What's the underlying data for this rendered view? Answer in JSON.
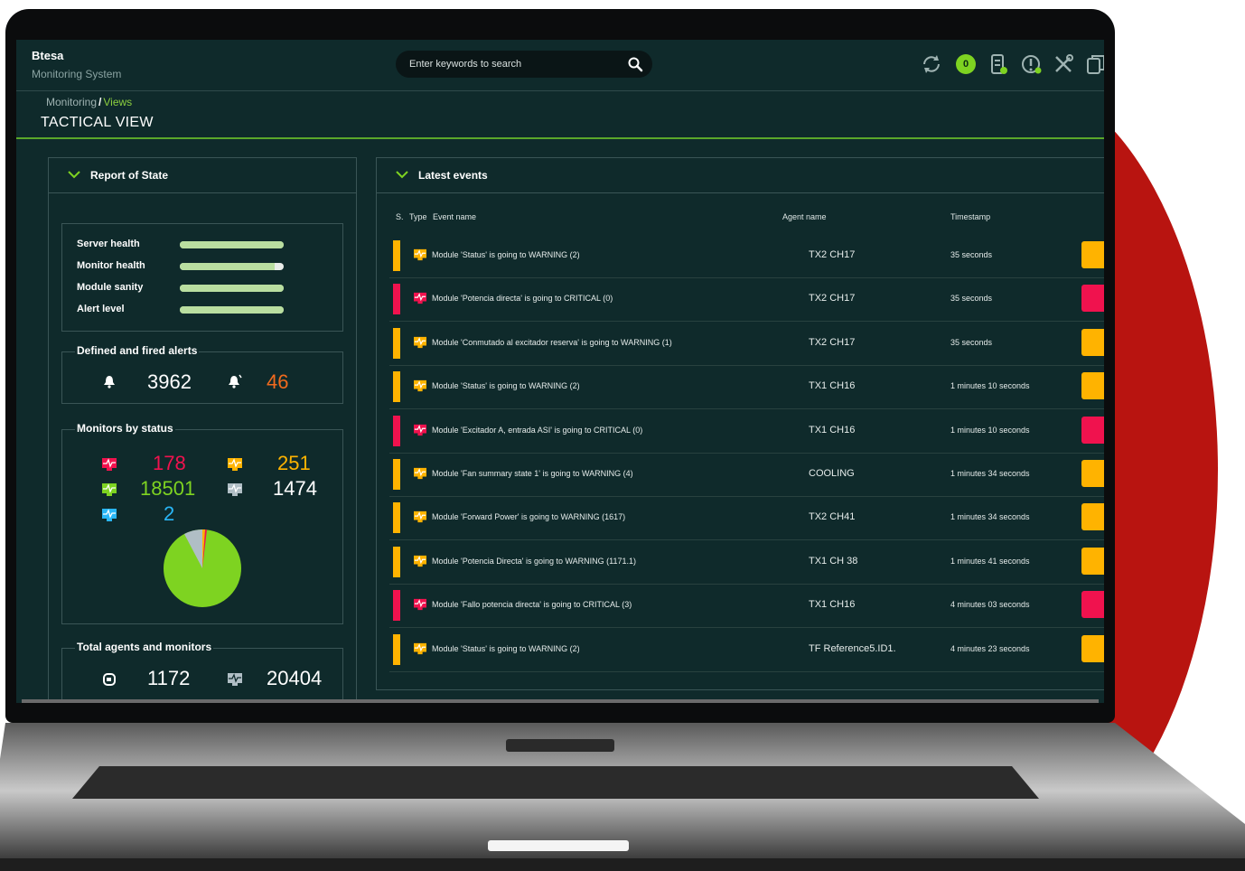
{
  "colors": {
    "accent": "#5aa72a",
    "warning": "#ffb300",
    "critical": "#f0124e",
    "ok": "#7ed321",
    "unknown": "#b0bec5",
    "info": "#29b6f6"
  },
  "header": {
    "brand": "Btesa",
    "subtitle": "Monitoring System",
    "search_placeholder": "Enter keywords to search",
    "notification_count": "0",
    "icons": [
      "refresh-icon",
      "notifications-badge",
      "server-icon",
      "alert-icon",
      "tools-icon",
      "copy-icon"
    ]
  },
  "breadcrumb": {
    "root": "Monitoring",
    "separator": "/",
    "current": "Views"
  },
  "page_title": "TACTICAL VIEW",
  "report": {
    "title": "Report of State",
    "health": [
      {
        "label": "Server health",
        "value": 100
      },
      {
        "label": "Monitor health",
        "value": 91
      },
      {
        "label": "Module sanity",
        "value": 100
      },
      {
        "label": "Alert level",
        "value": 100
      }
    ],
    "alerts": {
      "title": "Defined and fired alerts",
      "defined": "3962",
      "fired": "46"
    },
    "monitors": {
      "title": "Monitors by status",
      "critical": "178",
      "warning": "251",
      "ok": "18501",
      "unknown": "1474",
      "not_init": "2"
    },
    "totals": {
      "title": "Total agents and monitors",
      "agents": "1172",
      "monitors": "20404"
    }
  },
  "events": {
    "title": "Latest events",
    "columns": {
      "s": "S.",
      "type": "Type",
      "name": "Event name",
      "agent": "Agent name",
      "timestamp": "Timestamp"
    },
    "rows": [
      {
        "status": "warning",
        "name": "Module 'Status' is going to WARNING (2)",
        "agent": "TX2 CH17",
        "timestamp": "35 seconds"
      },
      {
        "status": "critical",
        "name": "Module 'Potencia directa' is going to CRITICAL (0)",
        "agent": "TX2 CH17",
        "timestamp": "35 seconds"
      },
      {
        "status": "warning",
        "name": "Module 'Conmutado al excitador reserva' is going to WARNING (1)",
        "agent": "TX2 CH17",
        "timestamp": "35 seconds"
      },
      {
        "status": "warning",
        "name": "Module 'Status' is going to WARNING (2)",
        "agent": "TX1 CH16",
        "timestamp": "1 minutes 10 seconds"
      },
      {
        "status": "critical",
        "name": "Module 'Excitador A, entrada ASI' is going to CRITICAL (0)",
        "agent": "TX1 CH16",
        "timestamp": "1 minutes 10 seconds"
      },
      {
        "status": "warning",
        "name": "Module 'Fan summary state 1' is going to WARNING (4)",
        "agent": "COOLING",
        "timestamp": "1 minutes 34 seconds"
      },
      {
        "status": "warning",
        "name": "Module 'Forward Power' is going to WARNING (1617)",
        "agent": "TX2 CH41",
        "timestamp": "1 minutes 34 seconds"
      },
      {
        "status": "warning",
        "name": "Module 'Potencia Directa' is going to WARNING (1171.1)",
        "agent": "TX1 CH 38",
        "timestamp": "1 minutes 41 seconds"
      },
      {
        "status": "critical",
        "name": "Module 'Fallo potencia directa' is going to CRITICAL (3)",
        "agent": "TX1 CH16",
        "timestamp": "4 minutes 03 seconds"
      },
      {
        "status": "warning",
        "name": "Module 'Status' is going to WARNING (2)",
        "agent": "TF Reference5.ID1.",
        "timestamp": "4 minutes 23 seconds"
      }
    ]
  }
}
